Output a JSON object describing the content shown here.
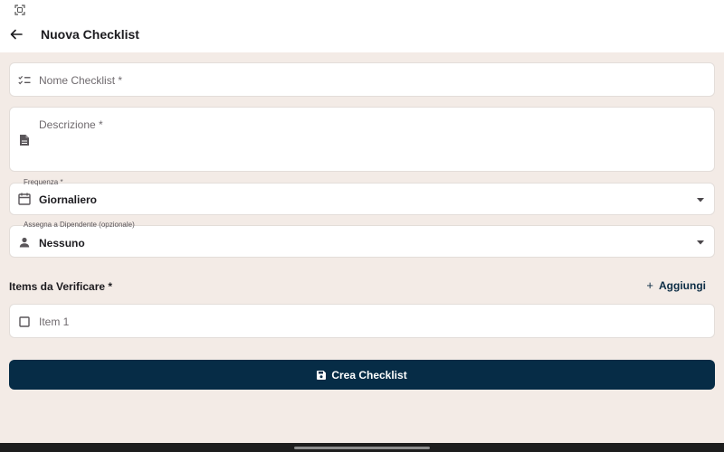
{
  "status_bar": {
    "icon": "screenshot-icon"
  },
  "app_bar": {
    "back_icon": "arrow-back-icon",
    "title": "Nuova Checklist"
  },
  "form": {
    "name_field": {
      "icon": "checklist-icon",
      "placeholder": "Nome Checklist *"
    },
    "description_field": {
      "icon": "description-icon",
      "placeholder": "Descrizione *"
    },
    "frequency_field": {
      "icon": "calendar-icon",
      "label": "Frequenza *",
      "value": "Giornaliero"
    },
    "assignee_field": {
      "icon": "person-icon",
      "label": "Assegna a Dipendente (opzionale)",
      "value": "Nessuno"
    }
  },
  "items_section": {
    "title": "Items da Verificare *",
    "add_label": "Aggiungi",
    "add_symbol": "+",
    "items": [
      {
        "placeholder": "Item 1",
        "icon": "checkbox-icon"
      }
    ]
  },
  "submit": {
    "icon": "save-icon",
    "label": "Crea Checklist"
  },
  "colors": {
    "background": "#f3ebe6",
    "primary": "#062c46",
    "surface": "#ffffff"
  }
}
